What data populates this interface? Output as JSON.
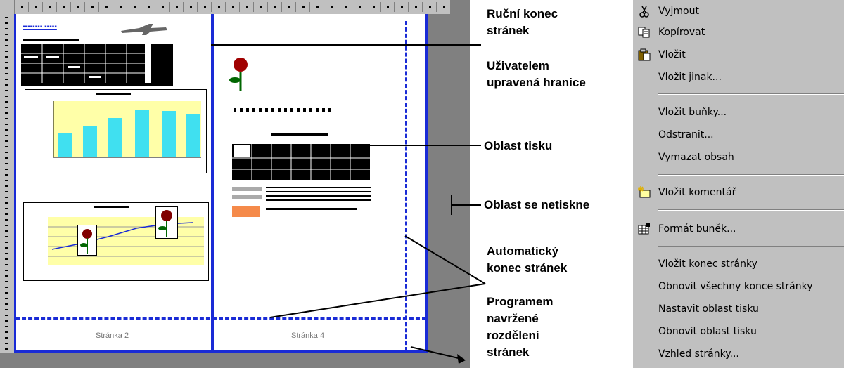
{
  "annotations": {
    "rucni_konec": [
      "Ruční konec",
      "stránek"
    ],
    "uzivatelem": [
      "Uživatelem",
      "upravená hranice"
    ],
    "oblast_tisku": "Oblast tisku",
    "oblast_netiskne": "Oblast se netiskne",
    "automaticky": [
      "Automatický",
      "konec  stránek"
    ],
    "programem": [
      "Programem",
      "navržené",
      "rozdělení",
      "stránek"
    ]
  },
  "pages": {
    "page2_label": "Stránka 2",
    "page4_label": "Stránka 4"
  },
  "context_menu": {
    "items": [
      {
        "label": "Vyjmout",
        "icon": "scissors-icon"
      },
      {
        "label": "Kopírovat",
        "icon": "copy-icon"
      },
      {
        "label": "Vložit",
        "icon": "paste-icon"
      },
      {
        "label": "Vložit jinak...",
        "icon": ""
      },
      {
        "label": "Vložit buňky...",
        "icon": ""
      },
      {
        "label": "Odstranit...",
        "icon": ""
      },
      {
        "label": "Vymazat obsah",
        "icon": ""
      },
      {
        "label": "Vložit komentář",
        "icon": "comment-icon"
      },
      {
        "label": "Formát buněk...",
        "icon": "format-cells-icon"
      },
      {
        "label": "Vložit konec stránky",
        "icon": ""
      },
      {
        "label": "Obnovit všechny konce stránky",
        "icon": ""
      },
      {
        "label": "Nastavit oblast tisku",
        "icon": ""
      },
      {
        "label": "Obnovit oblast tisku",
        "icon": ""
      },
      {
        "label": "Vzhled stránky...",
        "icon": ""
      }
    ]
  },
  "colors": {
    "page_break_blue": "#1a2bd6",
    "menu_bg": "#c0c0c0",
    "sheet_grey": "#808080"
  }
}
